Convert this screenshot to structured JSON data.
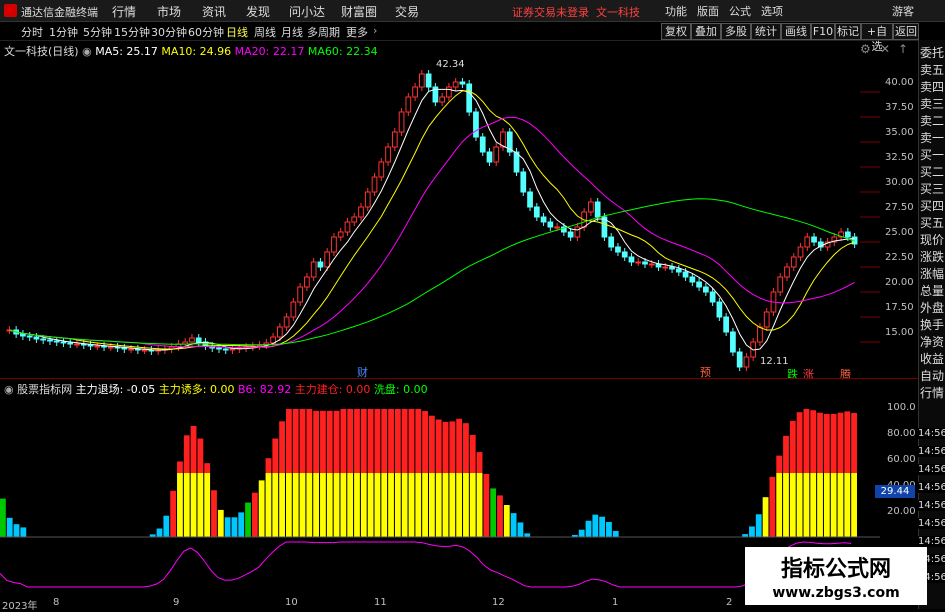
{
  "menubar": {
    "app_name": "通达信金融终端",
    "menus": [
      "行情",
      "市场",
      "资讯",
      "发现",
      "问小达",
      "财富圈",
      "交易"
    ],
    "warning": "证券交易未登录",
    "warning_stock": "文一科技",
    "right_menus": [
      "功能",
      "版面",
      "公式",
      "选项"
    ],
    "guest": "游客"
  },
  "periods": [
    "分时",
    "1分钟",
    "5分钟",
    "15分钟",
    "30分钟",
    "60分钟",
    "日线",
    "周线",
    "月线",
    "多周期",
    "更多"
  ],
  "active_period": "日线",
  "toolbar_buttons": [
    "复权",
    "叠加",
    "多股",
    "统计",
    "画线",
    "F10",
    "标记",
    "+自选",
    "返回"
  ],
  "legend": {
    "stock": "文一科技(日线)",
    "ma5": "MA5: 25.17",
    "ma10": "MA10: 24.96",
    "ma20": "MA20: 22.17",
    "ma60": "MA60: 22.34",
    "colors": {
      "ma5": "#ffffff",
      "ma10": "#ffff00",
      "ma20": "#ff00ff",
      "ma60": "#00ff00"
    }
  },
  "indicator_legend": {
    "name": "股票指标网",
    "items": [
      {
        "label": "主力退场: -0.05",
        "color": "#ffffff"
      },
      {
        "label": "主力诱多: 0.00",
        "color": "#ffff00"
      },
      {
        "label": "B6: 82.92",
        "color": "#ff00ff"
      },
      {
        "label": "主力建仓: 0.00",
        "color": "#ff2020"
      },
      {
        "label": "洗盘: 0.00",
        "color": "#00ff00"
      }
    ]
  },
  "price_axis": [
    "40.00",
    "37.50",
    "35.00",
    "32.50",
    "30.00",
    "27.50",
    "25.00",
    "22.50",
    "20.00",
    "17.50",
    "15.00"
  ],
  "indicator_axis": [
    "100.0",
    "80.00",
    "60.00",
    "40.00",
    "20.00"
  ],
  "indicator_value_box": "29.44",
  "annotations": {
    "high": "42.34",
    "low": "12.11",
    "events": [
      "财",
      "预",
      "跌",
      "涨",
      "腾"
    ]
  },
  "x_axis": [
    "2023年",
    "8",
    "9",
    "10",
    "11",
    "12",
    "1",
    "2"
  ],
  "right_panel": [
    "委托",
    "卖五",
    "卖四",
    "卖三",
    "卖二",
    "卖一",
    "买一",
    "买二",
    "买三",
    "买四",
    "买五",
    "现价",
    "涨跌",
    "涨幅",
    "总量",
    "外盘",
    "换手",
    "净资",
    "收益",
    "自动",
    "行情"
  ],
  "right_times": [
    "14:56",
    "14:56",
    "14:56",
    "14:56",
    "14:56",
    "14:56",
    "14:56",
    "14:56",
    "14:56"
  ],
  "watermark": {
    "title": "指标公式网",
    "url": "www.zbgs3.com"
  },
  "chart_data": {
    "type": "candlestick",
    "ylim": [
      13,
      43
    ],
    "ma_names": [
      "MA5",
      "MA10",
      "MA20",
      "MA60"
    ],
    "candles_approx_close": [
      16.2,
      15.8,
      15.6,
      15.5,
      15.3,
      15.2,
      15.1,
      15.0,
      14.9,
      14.8,
      14.8,
      14.7,
      14.6,
      14.6,
      14.5,
      14.5,
      14.4,
      14.3,
      14.3,
      14.2,
      14.2,
      14.1,
      14.2,
      14.3,
      14.5,
      14.8,
      15.0,
      15.4,
      15.0,
      14.6,
      14.4,
      14.3,
      14.2,
      14.3,
      14.4,
      14.5,
      14.6,
      14.7,
      14.9,
      15.5,
      16.5,
      17.5,
      19.0,
      20.5,
      21.5,
      23.0,
      22.5,
      24.0,
      25.5,
      26.0,
      27.0,
      27.5,
      28.5,
      30.0,
      31.5,
      33.0,
      34.5,
      36.0,
      38.0,
      39.5,
      40.5,
      41.8,
      40.5,
      39.0,
      39.5,
      40.5,
      41.0,
      40.8,
      38.0,
      35.5,
      34.0,
      33.0,
      34.5,
      36.0,
      34.0,
      32.0,
      30.0,
      28.5,
      27.5,
      27.0,
      26.5,
      26.5,
      26.0,
      25.5,
      26.5,
      28.0,
      29.0,
      27.5,
      25.5,
      24.5,
      24.0,
      23.5,
      23.0,
      23.0,
      22.8,
      22.8,
      22.5,
      22.5,
      22.3,
      22.0,
      21.5,
      21.0,
      20.5,
      20.0,
      19.0,
      17.5,
      16.0,
      14.0,
      12.5,
      13.5,
      15.0,
      16.5,
      18.0,
      20.0,
      21.5,
      22.5,
      23.5,
      24.5,
      25.5,
      25.0,
      24.5,
      25.0,
      25.5,
      26.0,
      25.5,
      24.8
    ]
  }
}
